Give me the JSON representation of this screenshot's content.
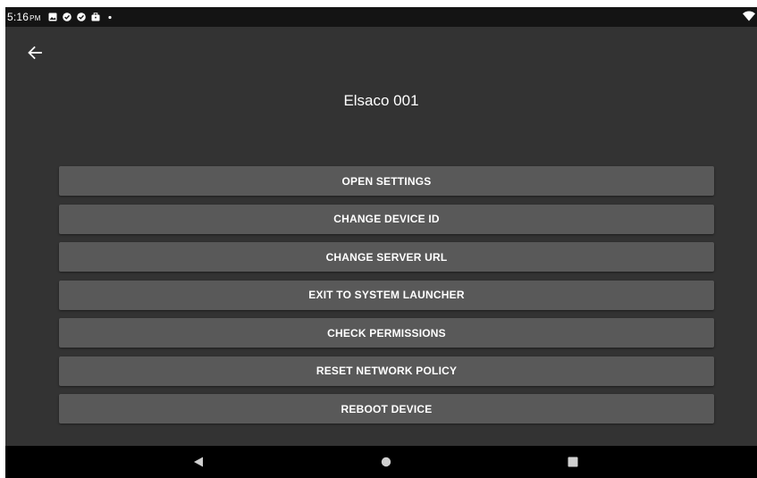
{
  "status_bar": {
    "time": "5:16",
    "ampm": "PM",
    "icons": [
      "image-icon",
      "check-circle-icon",
      "check-circle-icon",
      "briefcase-icon",
      "dot-icon"
    ],
    "right_icon": "wifi-icon"
  },
  "app_bar": {
    "back_icon": "arrow-left-icon"
  },
  "title": "Elsaco 001",
  "menu": [
    {
      "label": "OPEN SETTINGS"
    },
    {
      "label": "CHANGE DEVICE ID"
    },
    {
      "label": "CHANGE SERVER URL"
    },
    {
      "label": "EXIT TO SYSTEM LAUNCHER"
    },
    {
      "label": "CHECK PERMISSIONS"
    },
    {
      "label": "RESET NETWORK POLICY"
    },
    {
      "label": "REBOOT DEVICE"
    }
  ],
  "nav_bar": {
    "back": "nav-back-icon",
    "home": "nav-home-icon",
    "recents": "nav-recents-icon"
  },
  "colors": {
    "background": "#333333",
    "status_bar": "#141414",
    "button": "#595959",
    "nav_bar": "#000000",
    "text": "#ffffff"
  }
}
